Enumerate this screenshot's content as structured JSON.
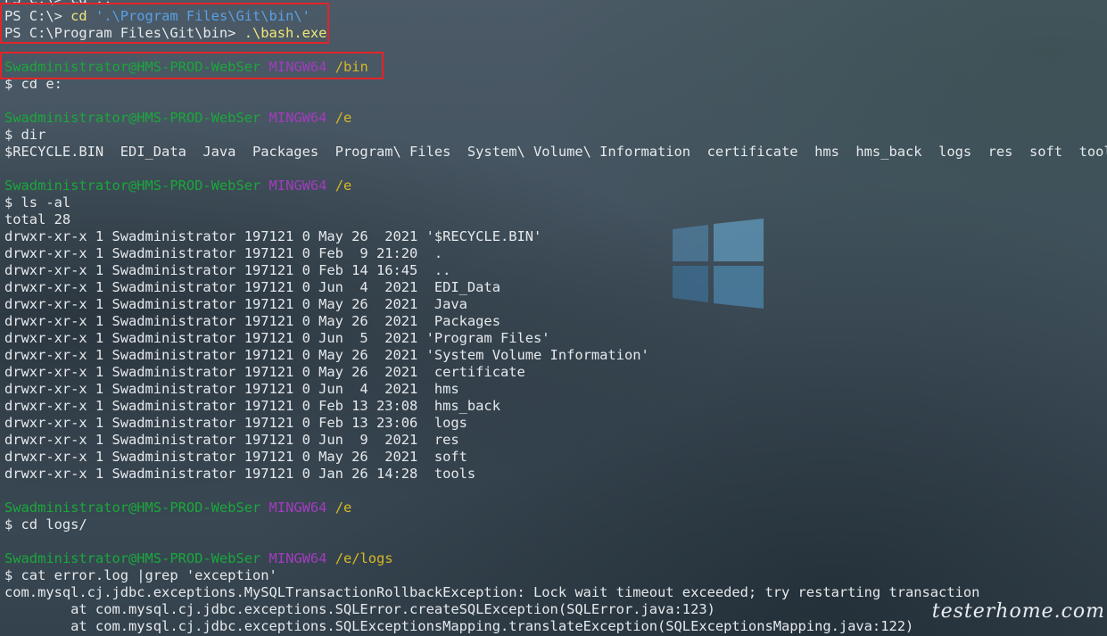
{
  "terminal": {
    "lines": [
      {
        "segs": [
          {
            "t": "PS C:\\> cd .."
          }
        ]
      },
      {
        "segs": [
          {
            "t": "PS C:\\> "
          },
          {
            "t": "cd",
            "c": "cmd"
          },
          {
            "t": " '.\\Program Files\\Git\\bin\\'",
            "c": "arg"
          }
        ]
      },
      {
        "segs": [
          {
            "t": "PS C:\\Program Files\\Git\\bin> "
          },
          {
            "t": ".\\bash.exe",
            "c": "cmd"
          }
        ]
      },
      {
        "segs": []
      },
      {
        "segs": [
          {
            "t": "Swadministrator@HMS-PROD-WebSer",
            "c": "user"
          },
          {
            "t": " "
          },
          {
            "t": "MINGW64",
            "c": "sys"
          },
          {
            "t": " "
          },
          {
            "t": "/bin",
            "c": "path"
          }
        ]
      },
      {
        "segs": [
          {
            "t": "$ cd e:"
          }
        ]
      },
      {
        "segs": []
      },
      {
        "segs": [
          {
            "t": "Swadministrator@HMS-PROD-WebSer",
            "c": "user"
          },
          {
            "t": " "
          },
          {
            "t": "MINGW64",
            "c": "sys"
          },
          {
            "t": " "
          },
          {
            "t": "/e",
            "c": "path"
          }
        ]
      },
      {
        "segs": [
          {
            "t": "$ dir"
          }
        ]
      },
      {
        "segs": [
          {
            "t": "$RECYCLE.BIN  EDI_Data  Java  Packages  Program\\ Files  System\\ Volume\\ Information  certificate  hms  hms_back  logs  res  soft  tools"
          }
        ]
      },
      {
        "segs": []
      },
      {
        "segs": [
          {
            "t": "Swadministrator@HMS-PROD-WebSer",
            "c": "user"
          },
          {
            "t": " "
          },
          {
            "t": "MINGW64",
            "c": "sys"
          },
          {
            "t": " "
          },
          {
            "t": "/e",
            "c": "path"
          }
        ]
      },
      {
        "segs": [
          {
            "t": "$ ls -al"
          }
        ]
      },
      {
        "segs": [
          {
            "t": "total 28"
          }
        ]
      },
      {
        "segs": [
          {
            "t": "drwxr-xr-x 1 Swadministrator 197121 0 May 26  2021 '$RECYCLE.BIN'"
          }
        ]
      },
      {
        "segs": [
          {
            "t": "drwxr-xr-x 1 Swadministrator 197121 0 Feb  9 21:20  ."
          }
        ]
      },
      {
        "segs": [
          {
            "t": "drwxr-xr-x 1 Swadministrator 197121 0 Feb 14 16:45  .."
          }
        ]
      },
      {
        "segs": [
          {
            "t": "drwxr-xr-x 1 Swadministrator 197121 0 Jun  4  2021  EDI_Data"
          }
        ]
      },
      {
        "segs": [
          {
            "t": "drwxr-xr-x 1 Swadministrator 197121 0 May 26  2021  Java"
          }
        ]
      },
      {
        "segs": [
          {
            "t": "drwxr-xr-x 1 Swadministrator 197121 0 May 26  2021  Packages"
          }
        ]
      },
      {
        "segs": [
          {
            "t": "drwxr-xr-x 1 Swadministrator 197121 0 Jun  5  2021 'Program Files'"
          }
        ]
      },
      {
        "segs": [
          {
            "t": "drwxr-xr-x 1 Swadministrator 197121 0 May 26  2021 'System Volume Information'"
          }
        ]
      },
      {
        "segs": [
          {
            "t": "drwxr-xr-x 1 Swadministrator 197121 0 May 26  2021  certificate"
          }
        ]
      },
      {
        "segs": [
          {
            "t": "drwxr-xr-x 1 Swadministrator 197121 0 Jun  4  2021  hms"
          }
        ]
      },
      {
        "segs": [
          {
            "t": "drwxr-xr-x 1 Swadministrator 197121 0 Feb 13 23:08  hms_back"
          }
        ]
      },
      {
        "segs": [
          {
            "t": "drwxr-xr-x 1 Swadministrator 197121 0 Feb 13 23:06  logs"
          }
        ]
      },
      {
        "segs": [
          {
            "t": "drwxr-xr-x 1 Swadministrator 197121 0 Jun  9  2021  res"
          }
        ]
      },
      {
        "segs": [
          {
            "t": "drwxr-xr-x 1 Swadministrator 197121 0 May 26  2021  soft"
          }
        ]
      },
      {
        "segs": [
          {
            "t": "drwxr-xr-x 1 Swadministrator 197121 0 Jan 26 14:28  tools"
          }
        ]
      },
      {
        "segs": []
      },
      {
        "segs": [
          {
            "t": "Swadministrator@HMS-PROD-WebSer",
            "c": "user"
          },
          {
            "t": " "
          },
          {
            "t": "MINGW64",
            "c": "sys"
          },
          {
            "t": " "
          },
          {
            "t": "/e",
            "c": "path"
          }
        ]
      },
      {
        "segs": [
          {
            "t": "$ cd logs/"
          }
        ]
      },
      {
        "segs": []
      },
      {
        "segs": [
          {
            "t": "Swadministrator@HMS-PROD-WebSer",
            "c": "user"
          },
          {
            "t": " "
          },
          {
            "t": "MINGW64",
            "c": "sys"
          },
          {
            "t": " "
          },
          {
            "t": "/e/logs",
            "c": "path"
          }
        ]
      },
      {
        "segs": [
          {
            "t": "$ cat error.log |grep 'exception'"
          }
        ]
      },
      {
        "segs": [
          {
            "t": "com.mysql.cj.jdbc.exceptions.MySQLTransactionRollbackException: Lock wait timeout exceeded; try restarting transaction"
          }
        ]
      },
      {
        "segs": [
          {
            "t": "        at com.mysql.cj.jdbc.exceptions.SQLError.createSQLException(SQLError.java:123)"
          }
        ]
      },
      {
        "segs": [
          {
            "t": "        at com.mysql.cj.jdbc.exceptions.SQLExceptionsMapping.translateException(SQLExceptionsMapping.java:122)"
          }
        ]
      }
    ]
  },
  "watermark": "testerhome.com",
  "colors": {
    "user": "#19a83a",
    "system": "#a43bbf",
    "path": "#d7b825",
    "highlight_box": "#e3242b"
  },
  "icons": {
    "background_logo": "windows-logo-icon"
  }
}
